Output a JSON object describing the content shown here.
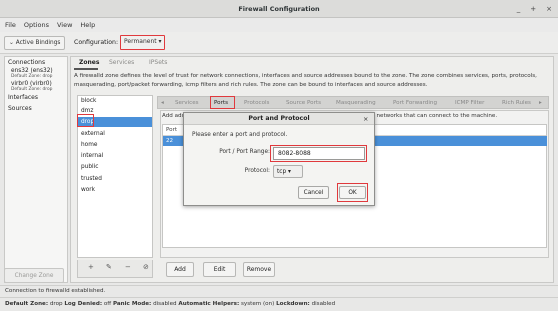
{
  "window": {
    "title": "Firewall Configuration",
    "controls": [
      "_",
      "+",
      "×"
    ]
  },
  "menu": [
    "File",
    "Options",
    "View",
    "Help"
  ],
  "toolbar": {
    "binding_toggle": "Active Bindings",
    "config_label": "Configuration:",
    "config_value": "Permanent"
  },
  "sidebar": {
    "connections_heading": "Connections",
    "conn1_name": "ens32 (ens32)",
    "conn1_zone": "Default Zone: drop",
    "conn2_name": "virbr0 (virbr0)",
    "conn2_zone": "Default Zone: drop",
    "interfaces": "Interfaces",
    "sources": "Sources",
    "change_zone": "Change Zone"
  },
  "main_tabs": [
    "Zones",
    "Services",
    "IPSets"
  ],
  "description": "A firewalld zone defines the level of trust for network connections, interfaces and source addresses bound to the zone. The zone combines services, ports, protocols, masquerading, port/packet forwarding, icmp filters and rich rules. The zone can be bound to interfaces and source addresses.",
  "zones": [
    "block",
    "dmz",
    "drop",
    "external",
    "home",
    "internal",
    "public",
    "trusted",
    "work"
  ],
  "zone_toolbar": [
    "+",
    "✎",
    "−",
    "⊘"
  ],
  "right_tabs": [
    "◂",
    "Services",
    "Ports",
    "Protocols",
    "Source Ports",
    "Masquerading",
    "Port Forwarding",
    "ICMP Filter",
    "Rich Rules",
    "▸"
  ],
  "ports_panel": {
    "desc_left": "Add addi",
    "desc_right": "or networks that can connect to the machine.",
    "column_header": "Port",
    "selected_row": "22",
    "buttons": [
      "Add",
      "Edit",
      "Remove"
    ]
  },
  "status": {
    "line1": "Connection to firewalld established.",
    "default_zone_label": "Default Zone:",
    "default_zone": "drop",
    "log_denied_label": "Log Denied:",
    "log_denied": "off",
    "panic_label": "Panic Mode:",
    "panic": "disabled",
    "helpers_label": "Automatic Helpers:",
    "helpers": "system (on)",
    "lockdown_label": "Lockdown:",
    "lockdown": "disabled"
  },
  "dialog": {
    "title": "Port and Protocol",
    "close": "×",
    "prompt": "Please enter a port and protocol.",
    "range_label": "Port / Port Range:",
    "range_value": "8082-8088",
    "protocol_label": "Protocol:",
    "protocol_value": "tcp",
    "cancel": "Cancel",
    "ok": "OK"
  },
  "colors": {
    "selection": "#4a90d9",
    "highlight_box": "#e0393d"
  }
}
